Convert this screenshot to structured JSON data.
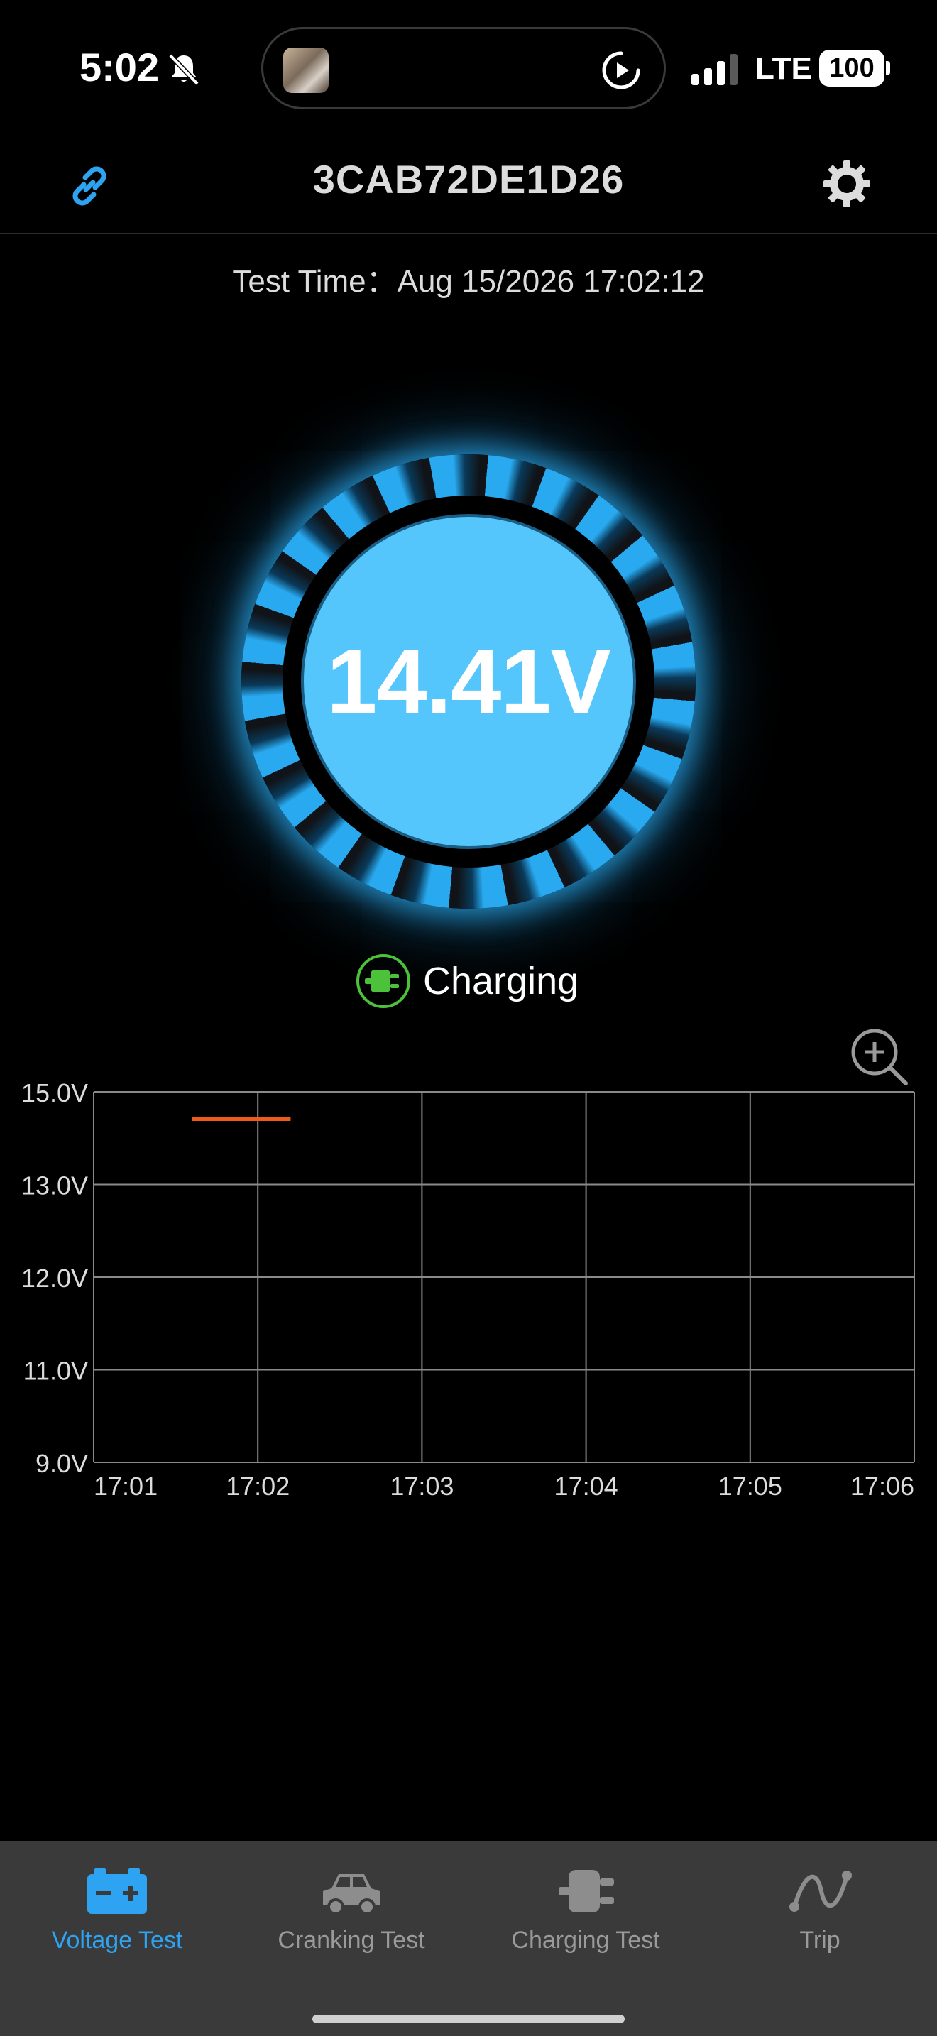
{
  "status_bar": {
    "time": "5:02",
    "network": "LTE",
    "battery": "100"
  },
  "header": {
    "title": "3CAB72DE1D26",
    "left_icon": "link-icon",
    "right_icon": "gear-icon"
  },
  "test_time": "Test Time：Aug 15/2026 17:02:12",
  "gauge": {
    "voltage": "14.41V",
    "accent_color": "#29aaf0"
  },
  "charging": {
    "label": "Charging",
    "icon": "plug-icon",
    "color": "#4cc23a"
  },
  "chart_data": {
    "type": "line",
    "y_tick_labels": [
      "15.0V",
      "13.0V",
      "12.0V",
      "11.0V",
      "9.0V"
    ],
    "x_tick_labels": [
      "17:01",
      "17:02",
      "17:03",
      "17:04",
      "17:05",
      "17:06"
    ],
    "series": [
      {
        "color": "#f05a1a",
        "points": [
          {
            "x": "17:01:36",
            "y": 14.41
          },
          {
            "x": "17:02:12",
            "y": 14.41
          }
        ]
      }
    ],
    "grid": true
  },
  "tabs": [
    {
      "label": "Voltage Test",
      "icon": "battery-icon",
      "active": true
    },
    {
      "label": "Cranking Test",
      "icon": "car-icon",
      "active": false
    },
    {
      "label": "Charging Test",
      "icon": "plug-icon",
      "active": false
    },
    {
      "label": "Trip",
      "icon": "route-icon",
      "active": false
    }
  ]
}
